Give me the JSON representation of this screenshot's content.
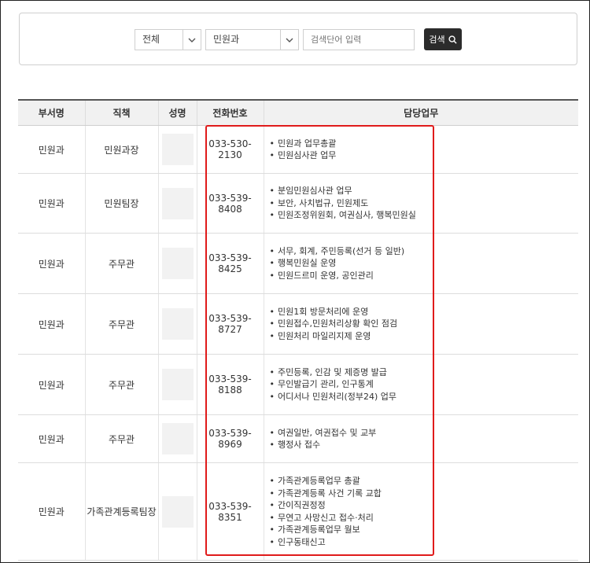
{
  "search": {
    "scope_select": "전체",
    "dept_select": "민원과",
    "keyword_placeholder": "검색단어 입력",
    "button_label": "검색"
  },
  "table": {
    "headers": [
      "부서명",
      "직책",
      "성명",
      "전화번호",
      "담당업무"
    ],
    "rows": [
      {
        "dept": "민원과",
        "position": "민원과장",
        "phone": "033-530-2130",
        "duties": [
          "민원과 업무총괄",
          "민원심사관 업무"
        ]
      },
      {
        "dept": "민원과",
        "position": "민원팀장",
        "phone": "033-539-8408",
        "duties": [
          "분임민원심사관 업무",
          "보안, 사치법규, 민원제도",
          "민원조정위원회, 여권심사, 행복민원실"
        ]
      },
      {
        "dept": "민원과",
        "position": "주무관",
        "phone": "033-539-8425",
        "duties": [
          "서무, 회계, 주민등록(선거 등 일반)",
          "행복민원실 운영",
          "민원드르미 운영, 공인관리"
        ]
      },
      {
        "dept": "민원과",
        "position": "주무관",
        "phone": "033-539-8727",
        "duties": [
          "민원1회 방문처리에 운영",
          "민원접수,민원처리상황 확인 점검",
          "민원처리 마일리지제 운영"
        ]
      },
      {
        "dept": "민원과",
        "position": "주무관",
        "phone": "033-539-8188",
        "duties": [
          "주민등록, 인감 및 제증명 발급",
          "무인발급기 관리, 인구통계",
          "어디서나 민원처리(정부24) 업무"
        ]
      },
      {
        "dept": "민원과",
        "position": "주무관",
        "phone": "033-539-8969",
        "duties": [
          "여권일반, 여권접수 및 교부",
          "행정사 접수"
        ]
      },
      {
        "dept": "민원과",
        "position": "가족관계등록팀장",
        "phone": "033-539-8351",
        "duties": [
          "가족관계등록업무 총괄",
          "가족관계등록 사건 기록 교합",
          "간이직권정정",
          "무연고 사망신고 접수·처리",
          "가족관계등록업무 월보",
          "인구동태신고"
        ]
      }
    ]
  },
  "colors": {
    "highlight": "#e01b1b",
    "button": "#2b2b2b",
    "header_bg": "#f1f1f1"
  }
}
